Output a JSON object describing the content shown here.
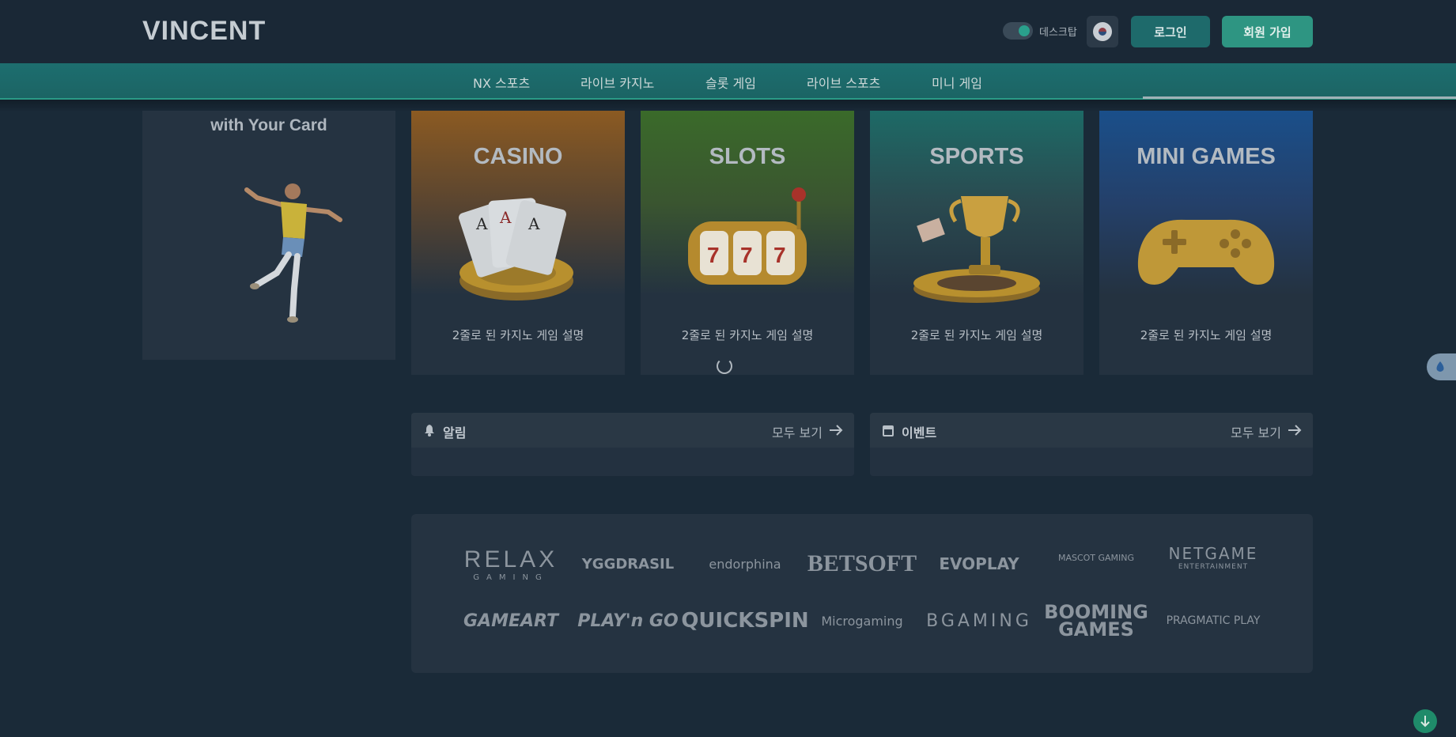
{
  "header": {
    "logo_text": "VINCENT",
    "view_toggle_label": "데스크탑",
    "login_label": "로그인",
    "signup_label": "회원 가입",
    "language_flag": "kr-flag-icon"
  },
  "nav": {
    "items": [
      {
        "label": "NX 스포츠"
      },
      {
        "label": "라이브 카지노"
      },
      {
        "label": "슬롯 게임"
      },
      {
        "label": "라이브 스포츠"
      },
      {
        "label": "미니 게임"
      }
    ]
  },
  "promo": {
    "title": "with Your Card",
    "image": "soccer-player-image"
  },
  "categories": [
    {
      "title": "CASINO",
      "desc": "2줄로 된 카지노 게임 설명",
      "icon": "cards-chip-icon",
      "color": "#c4851a"
    },
    {
      "title": "SLOTS",
      "desc": "2줄로 된 카지노 게임 설명",
      "icon": "slot-machine-icon",
      "color": "#4f8a2c"
    },
    {
      "title": "SPORTS",
      "desc": "2줄로 된 카지노 게임 설명",
      "icon": "trophy-icon",
      "color": "#1f8a82"
    },
    {
      "title": "MINI GAMES",
      "desc": "2줄로 된 카지노 게임 설명",
      "icon": "gamepad-icon",
      "color": "#1f5fa6"
    }
  ],
  "panels": {
    "notice": {
      "title": "알림",
      "more": "모두 보기"
    },
    "events": {
      "title": "이벤트",
      "more": "모두 보기"
    }
  },
  "providers": [
    {
      "name": "RELAX",
      "sub": "GAMING"
    },
    {
      "name": "YGGDRASIL",
      "sub": ""
    },
    {
      "name": "endorphina",
      "sub": ""
    },
    {
      "name": "BETSOFT",
      "sub": ""
    },
    {
      "name": "EVOPLAY",
      "sub": ""
    },
    {
      "name": "MASCOT GAMING",
      "sub": ""
    },
    {
      "name": "NETGAME",
      "sub": "ENTERTAINMENT"
    },
    {
      "name": "GAMEART",
      "sub": ""
    },
    {
      "name": "PLAY'n GO",
      "sub": ""
    },
    {
      "name": "QUICKSPIN",
      "sub": ""
    },
    {
      "name": "Microgaming",
      "sub": ""
    },
    {
      "name": "BGAMING",
      "sub": ""
    },
    {
      "name": "BOOMING",
      "sub": "GAMES"
    },
    {
      "name": "PRAGMATIC PLAY",
      "sub": ""
    }
  ],
  "colors": {
    "accent": "#2e9582",
    "nav_bg": "#1d6e6f",
    "page_bg": "#1a2a38"
  }
}
